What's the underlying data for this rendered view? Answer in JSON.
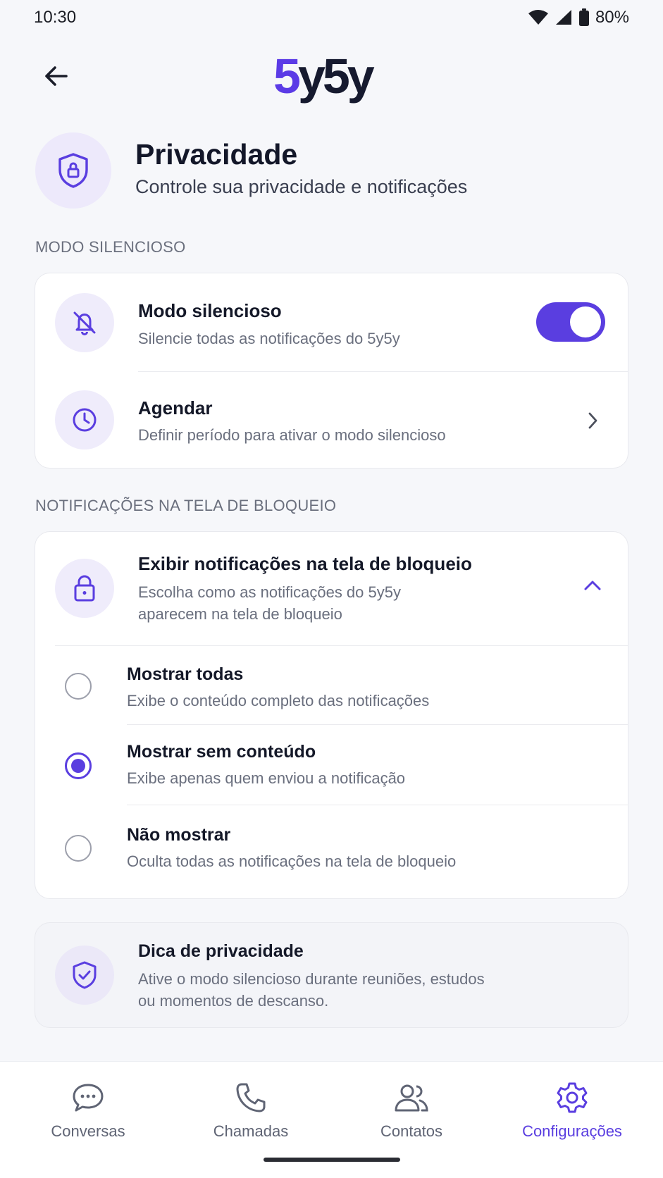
{
  "status_bar": {
    "time": "10:30",
    "battery": "80%"
  },
  "header": {
    "brand_part1": "5",
    "brand_part2": "y5y",
    "back_icon": "arrow-left-icon"
  },
  "page": {
    "title": "Privacidade",
    "subtitle": "Controle sua privacidade e notificações",
    "icon": "shield-lock-icon"
  },
  "silent_section": {
    "label": "MODO SILENCIOSO",
    "silent_mode": {
      "title": "Modo silencioso",
      "desc": "Silencie todas as notificações do 5y5y",
      "enabled": true,
      "icon": "bell-off-icon"
    },
    "schedule": {
      "title": "Agendar",
      "desc": "Definir período para ativar o modo silencioso",
      "icon": "clock-icon"
    }
  },
  "lockscreen_section": {
    "label": "NOTIFICAÇÕES NA TELA DE BLOQUEIO",
    "header": {
      "title": "Exibir notificações na tela de bloqueio",
      "desc_line1": "Escolha como as notificações do 5y5y",
      "desc_line2": "aparecem na tela de bloqueio",
      "icon": "lock-icon",
      "expanded": true
    },
    "options": [
      {
        "title": "Mostrar todas",
        "desc": "Exibe o conteúdo completo das notificações",
        "selected": false
      },
      {
        "title": "Mostrar sem conteúdo",
        "desc": "Exibe apenas quem enviou a notificação",
        "selected": true
      },
      {
        "title": "Não mostrar",
        "desc": "Oculta todas as notificações na tela de bloqueio",
        "selected": false
      }
    ]
  },
  "tip": {
    "title": "Dica de privacidade",
    "desc_line1": "Ative o modo silencioso durante reuniões, estudos",
    "desc_line2": "ou momentos de descanso.",
    "icon": "shield-check-icon"
  },
  "bottom_nav": [
    {
      "label": "Conversas",
      "icon": "chat-bubble-icon",
      "active": false
    },
    {
      "label": "Chamadas",
      "icon": "phone-icon",
      "active": false
    },
    {
      "label": "Contatos",
      "icon": "people-icon",
      "active": false
    },
    {
      "label": "Configurações",
      "icon": "gear-icon",
      "active": true
    }
  ],
  "colors": {
    "accent": "#5a3ee0",
    "icon_bg": "#efecfb",
    "background": "#f6f7fa"
  }
}
